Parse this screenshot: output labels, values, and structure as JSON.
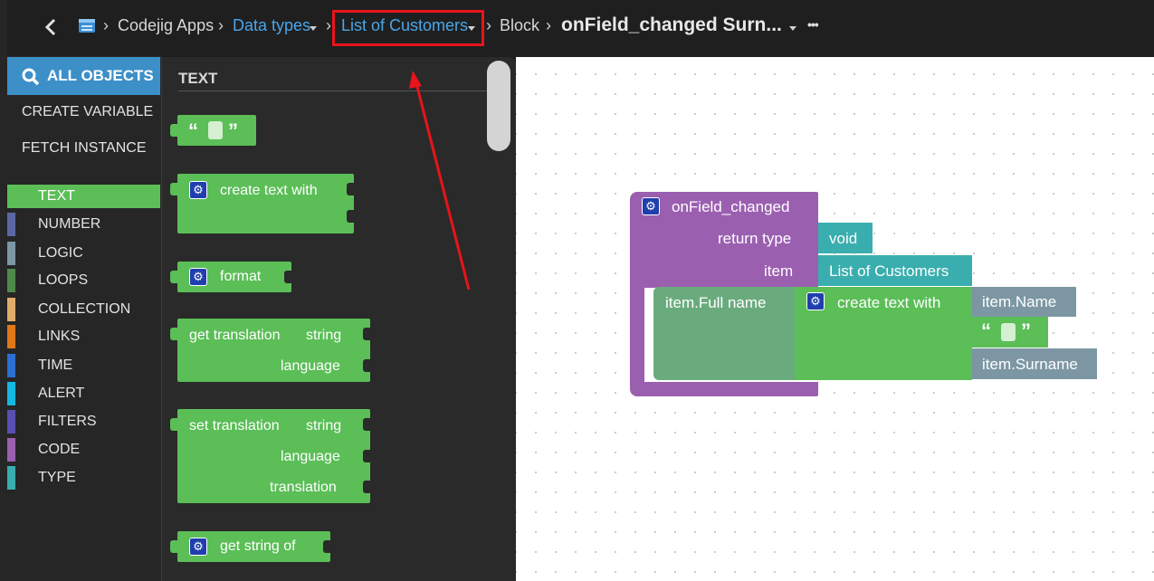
{
  "breadcrumb": {
    "back_icon": "chevron-left-icon",
    "app_icon": "window-icon",
    "items": [
      "Codejig Apps",
      "Data types",
      "List of Customers",
      "Block"
    ],
    "title": "onField_changed Surn...",
    "more": "•••"
  },
  "sidebar": {
    "search_label": "ALL OBJECTS",
    "menu": [
      "CREATE VARIABLE",
      "FETCH INSTANCE"
    ],
    "categories": [
      {
        "label": "TEXT",
        "color": "#5bbe57"
      },
      {
        "label": "NUMBER",
        "color": "#5b67a5"
      },
      {
        "label": "LOGIC",
        "color": "#7c97a3"
      },
      {
        "label": "LOOPS",
        "color": "#4f8a4b"
      },
      {
        "label": "COLLECTION",
        "color": "#e0ad6b"
      },
      {
        "label": "LINKS",
        "color": "#e0781a"
      },
      {
        "label": "TIME",
        "color": "#2a6fd1"
      },
      {
        "label": "ALERT",
        "color": "#14b8e0"
      },
      {
        "label": "FILTERS",
        "color": "#5a4fb0"
      },
      {
        "label": "CODE",
        "color": "#9b5fb0"
      },
      {
        "label": "TYPE",
        "color": "#3aaeae"
      }
    ]
  },
  "flyout": {
    "heading": "TEXT",
    "blocks": {
      "create_text": "create text with",
      "format": "format",
      "get_translation": "get translation",
      "string": "string",
      "language": "language",
      "set_translation": "set translation",
      "translation": "translation",
      "get_string": "get string of"
    }
  },
  "canvas": {
    "function_name": "onField_changed",
    "return_type_label": "return type",
    "return_type_value": "void",
    "item_label": "item",
    "item_value": "List of Customers",
    "assign_target": "item.Full name",
    "create_text": "create text with",
    "arg1": "item.Name",
    "arg3": "item.Surname"
  },
  "colors": {
    "text_category": "#5bbe57",
    "code_category": "#9b5fb0",
    "type_category": "#3aaeae",
    "link": "#49a6ea",
    "highlight": "#e8141a"
  }
}
